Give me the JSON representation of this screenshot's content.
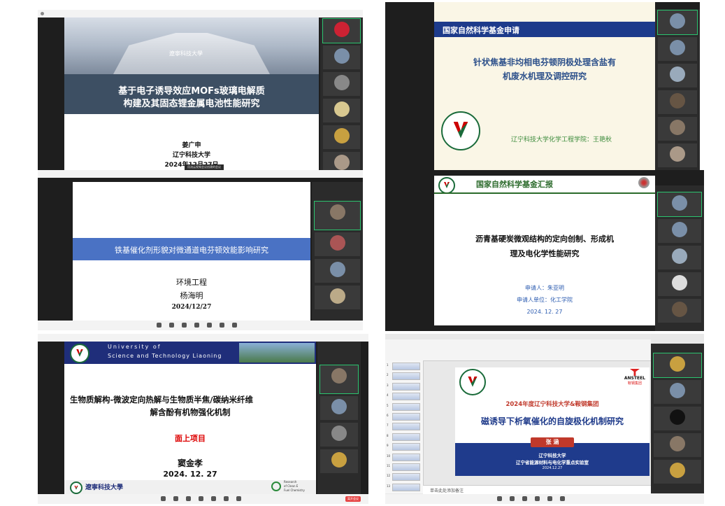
{
  "panels": {
    "p1": {
      "title_line1": "基于电子诱导效应MOFs玻璃电解质",
      "title_line2": "构建及其固态锂金属电池性能研究",
      "presenter": "姜广申",
      "university": "辽宁科技大学",
      "date": "2024年12月27日",
      "banner_logo_text": "遼寧科技大學",
      "caption": "用流云视频会议创建的会议"
    },
    "p2": {
      "header": "国家自然科学基金申请",
      "title_line1": "针状焦基非均相电芬顿阴极处理含盐有",
      "title_line2": "机废水机理及调控研究",
      "footer": "辽宁科技大学化学工程学院：王艳秋"
    },
    "p3": {
      "title": "铁基催化剂形貌对微通道电芬顿效能影响研究",
      "field": "环境工程",
      "presenter": "杨海明",
      "date": "2024/12/27"
    },
    "p4": {
      "header": "国家自然科学基金汇报",
      "title_line1": "沥青基硬炭微观结构的定向创制、形成机",
      "title_line2": "理及电化学性能研究",
      "applicant": "申请人：朱亚明",
      "unit": "申请人单位：化工学院",
      "date": "2024. 12. 27"
    },
    "p5": {
      "banner_line1": "University of",
      "banner_line2": "Science and Technology Liaoning",
      "title_line1": "生物质解构-微波定向热解与生物质半焦/碳纳米纤维",
      "title_line2": "解含酚有机物强化机制",
      "project_type": "面上项目",
      "presenter": "窦金孝",
      "date": "2024. 12. 27",
      "footer_logo": "遼寧科技大學",
      "footer_right_line1": "Research",
      "footer_right_line2": "of Clean E",
      "footer_right_line3": "Fuel Chemistry",
      "end_meeting": "离开会议"
    },
    "p6": {
      "top_line": "2024年度辽宁科技大学&鞍钢集团",
      "title": "磁诱导下析氧催化的自旋极化机制研究",
      "presenter": "张 涵",
      "affil_line1": "辽宁科技大学",
      "affil_line2": "辽宁省能源材料与电化学重点实验室",
      "affil_date": "2024.12.27",
      "ansteel": "ANSTEEL",
      "ansteel_cn": "鞍钢集团",
      "notes_placeholder": "单击此处添加备注",
      "thumbs": [
        "1",
        "2",
        "3",
        "4",
        "5",
        "6",
        "7",
        "8",
        "9",
        "10",
        "11",
        "12",
        "13"
      ]
    }
  },
  "colors": {
    "accent_green": "#2bc46f",
    "nsfc_blue": "#1e3a8a",
    "title_blue": "#2b4f8a",
    "brand_red": "#e64545"
  }
}
